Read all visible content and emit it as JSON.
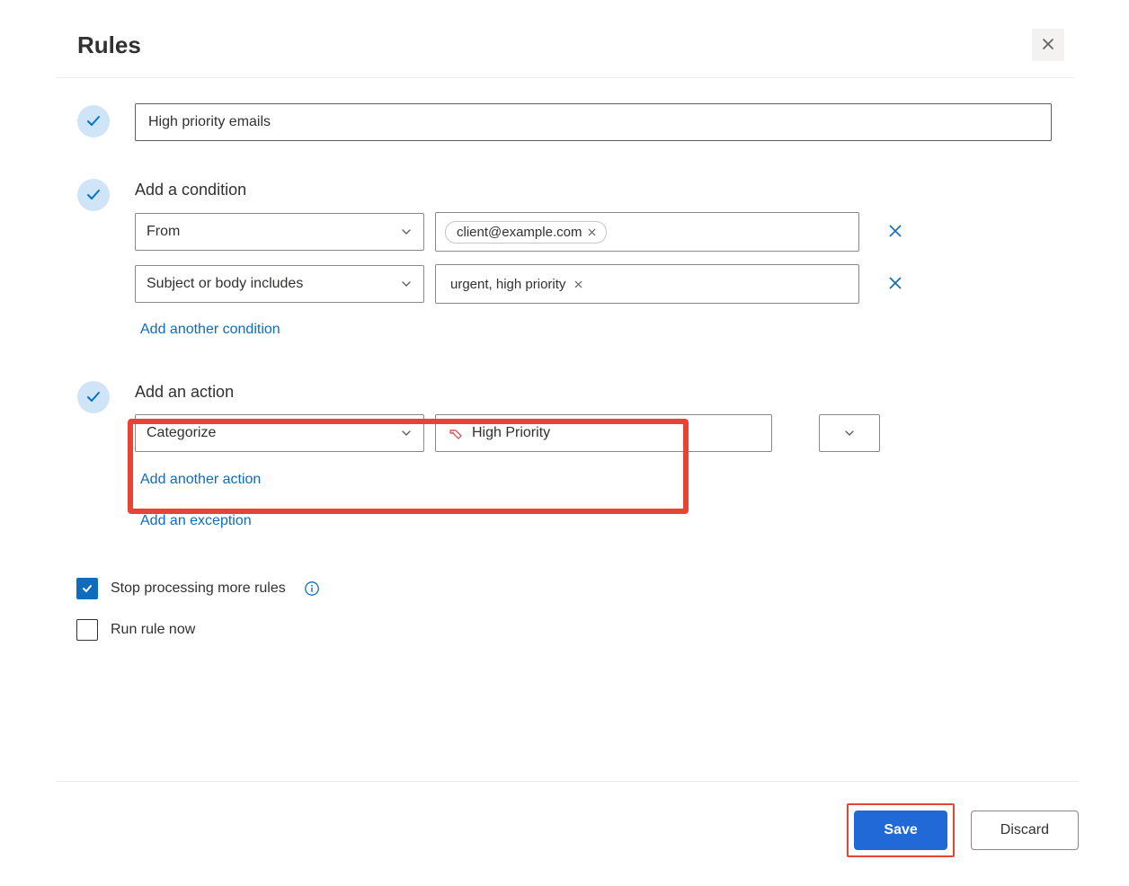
{
  "title": "Rules",
  "rule_name": "High priority emails",
  "condition_label": "Add a condition",
  "conditions": [
    {
      "type": "From",
      "value": "client@example.com"
    },
    {
      "type": "Subject or body includes",
      "value": "urgent, high priority"
    }
  ],
  "add_condition_link": "Add another condition",
  "action_label": "Add an action",
  "action": {
    "type": "Categorize",
    "value": "High Priority"
  },
  "add_action_link": "Add another action",
  "add_exception_link": "Add an exception",
  "options": {
    "stop_processing": {
      "label": "Stop processing more rules",
      "checked": true
    },
    "run_now": {
      "label": "Run rule now",
      "checked": false
    }
  },
  "buttons": {
    "save": "Save",
    "discard": "Discard"
  }
}
